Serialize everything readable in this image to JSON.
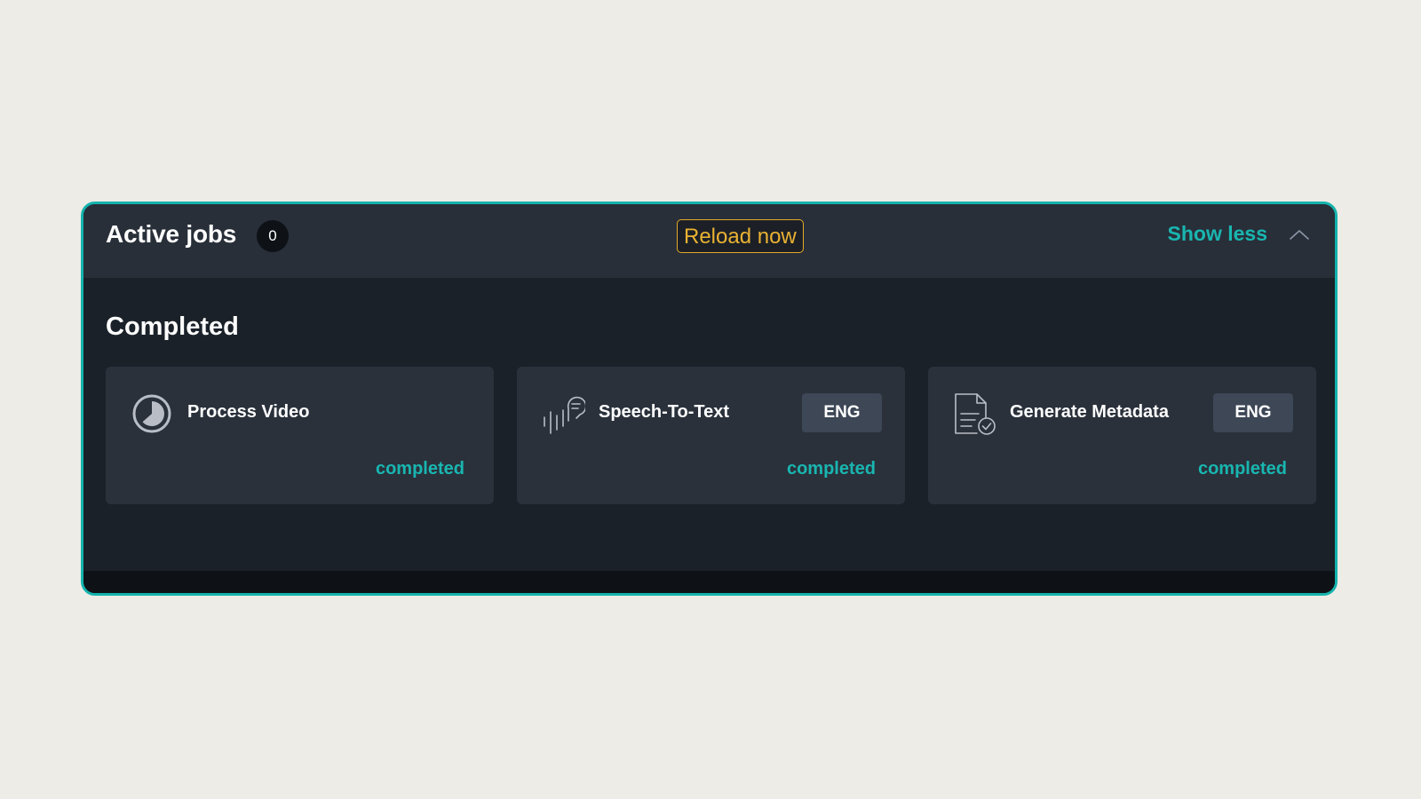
{
  "header": {
    "title": "Active jobs",
    "count": "0",
    "reload_label": "Reload now",
    "toggle_label": "Show less"
  },
  "section": {
    "title": "Completed"
  },
  "jobs": [
    {
      "title": "Process Video",
      "icon": "progress-pie-icon",
      "badge": "",
      "status": "completed"
    },
    {
      "title": "Speech-To-Text",
      "icon": "speech-icon",
      "badge": "ENG",
      "status": "completed"
    },
    {
      "title": "Generate Metadata",
      "icon": "document-check-icon",
      "badge": "ENG",
      "status": "completed"
    }
  ],
  "colors": {
    "accent": "#19b6b0",
    "warning": "#eab233",
    "panel_bg": "#1a2129",
    "header_bg": "#282f39",
    "card_bg": "#2a313b"
  }
}
